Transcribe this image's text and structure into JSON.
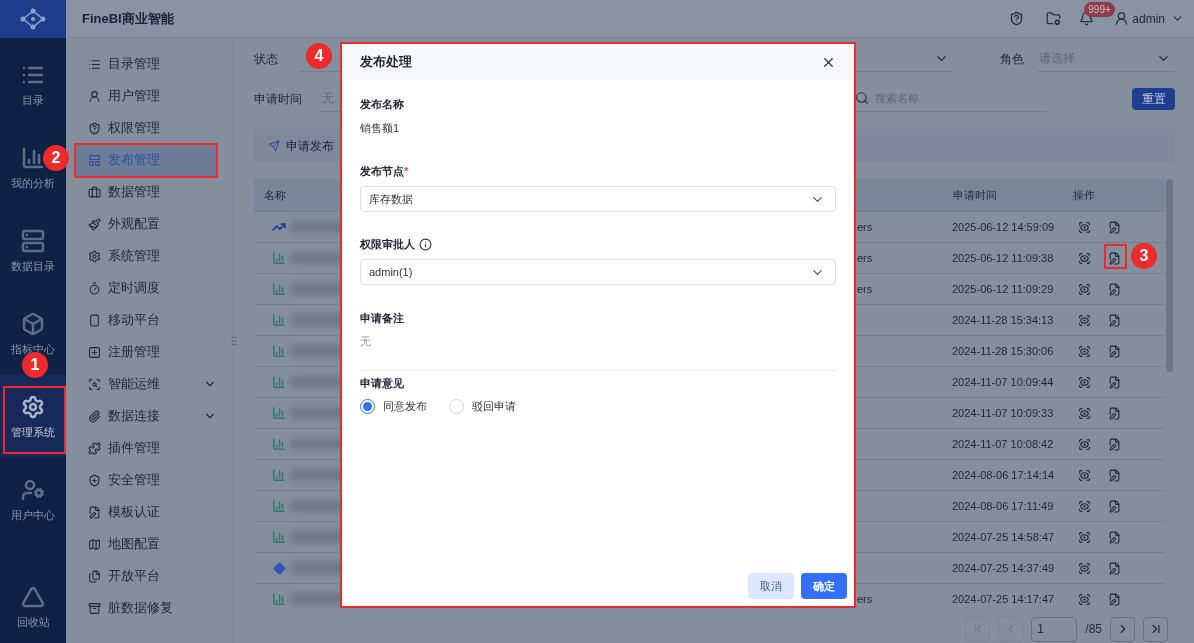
{
  "app": {
    "title": "FineBI商业智能"
  },
  "header": {
    "notification_badge": "999+",
    "user": "admin"
  },
  "rail": [
    {
      "label": "目录",
      "selected": false
    },
    {
      "label": "我的分析",
      "selected": false
    },
    {
      "label": "数据目录",
      "selected": false
    },
    {
      "label": "指标中心",
      "selected": false
    },
    {
      "label": "管理系统",
      "selected": true
    },
    {
      "label": "用户中心",
      "selected": false
    }
  ],
  "rail_footer": {
    "label": "回收站"
  },
  "nav": [
    {
      "label": "目录管理",
      "selected": false
    },
    {
      "label": "用户管理",
      "selected": false
    },
    {
      "label": "权限管理",
      "selected": false
    },
    {
      "label": "发布管理",
      "selected": true
    },
    {
      "label": "数据管理",
      "selected": false
    },
    {
      "label": "外观配置",
      "selected": false
    },
    {
      "label": "系统管理",
      "selected": false
    },
    {
      "label": "定时调度",
      "selected": false
    },
    {
      "label": "移动平台",
      "selected": false
    },
    {
      "label": "注册管理",
      "selected": false
    },
    {
      "label": "智能运维",
      "selected": false,
      "expandable": true
    },
    {
      "label": "数据连接",
      "selected": false,
      "expandable": true
    },
    {
      "label": "插件管理",
      "selected": false
    },
    {
      "label": "安全管理",
      "selected": false
    },
    {
      "label": "模板认证",
      "selected": false
    },
    {
      "label": "地图配置",
      "selected": false
    },
    {
      "label": "开放平台",
      "selected": false
    },
    {
      "label": "脏数据修复",
      "selected": false
    }
  ],
  "filters": {
    "status": {
      "label": "状态"
    },
    "role": {
      "label": "角色",
      "placeholder": "请选择"
    },
    "time": {
      "label": "申请时间",
      "value": "无"
    },
    "search": {
      "placeholder": "搜索名称"
    },
    "reset": "重置"
  },
  "notice": "申请发布",
  "table": {
    "columns": [
      "名称",
      "申请时间",
      "操作"
    ],
    "rows": [
      {
        "kind": "line",
        "column_3": "ers",
        "time": "2025-06-12 14:59:09"
      },
      {
        "kind": "bar",
        "column_3": "ers",
        "time": "2025-06-12 11:09:38"
      },
      {
        "kind": "bar",
        "column_3": "ers",
        "time": "2025-06-12 11:09:29"
      },
      {
        "kind": "bar",
        "time": "2024-11-28 15:34:13"
      },
      {
        "kind": "bar",
        "time": "2024-11-28 15:30:06"
      },
      {
        "kind": "bar",
        "time": "2024-11-07 10:09:44"
      },
      {
        "kind": "bar",
        "time": "2024-11-07 10:09:33"
      },
      {
        "kind": "bar",
        "time": "2024-11-07 10:08:42"
      },
      {
        "kind": "bar",
        "time": "2024-08-06 17:14:14"
      },
      {
        "kind": "bar",
        "time": "2024-08-06 17:11:49"
      },
      {
        "kind": "bar",
        "time": "2024-07-25 14:58:47"
      },
      {
        "kind": "diamond",
        "time": "2024-07-25 14:37:49"
      },
      {
        "kind": "bar",
        "column_3": "ers",
        "time": "2024-07-25 14:17:47"
      }
    ]
  },
  "pagination": {
    "page": "1",
    "total": "/85",
    "buttons": [
      {
        "kind": "first",
        "disabled": true
      },
      {
        "kind": "prev",
        "disabled": true
      },
      {
        "kind": "next",
        "disabled": false
      },
      {
        "kind": "last",
        "disabled": false
      }
    ]
  },
  "dialog": {
    "title": "发布处理",
    "fields": [
      {
        "kind": "text",
        "label": "发布名称",
        "value": "销售额1"
      },
      {
        "kind": "select",
        "label": "发布节点",
        "required_mark": "*",
        "value": "库存数据"
      },
      {
        "kind": "select",
        "label": "权限审批人",
        "info": true,
        "value": "admin(1)"
      },
      {
        "kind": "note",
        "label": "申请备注",
        "value": "无"
      }
    ],
    "opinion": {
      "label": "申请意见",
      "options": [
        {
          "label": "同意发布",
          "selected": true
        },
        {
          "label": "驳回申请",
          "selected": false
        }
      ]
    },
    "buttons": [
      {
        "kind": "secondary",
        "label": "取消"
      },
      {
        "kind": "primary",
        "label": "确定"
      }
    ]
  },
  "annotations": [
    {
      "number": "1"
    },
    {
      "number": "2"
    },
    {
      "number": "3"
    },
    {
      "number": "4"
    }
  ]
}
